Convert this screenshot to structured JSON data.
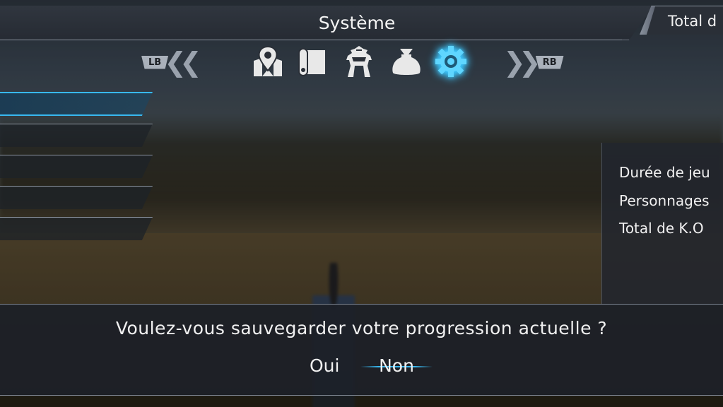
{
  "header": {
    "title": "Système",
    "total_tab_label": "Total d"
  },
  "tabs": {
    "left_shoulder": "LB",
    "right_shoulder": "RB",
    "icons": [
      {
        "name": "map-icon",
        "active": false
      },
      {
        "name": "scroll-icon",
        "active": false
      },
      {
        "name": "helmet-icon",
        "active": false
      },
      {
        "name": "bag-icon",
        "active": false
      },
      {
        "name": "gear-icon",
        "active": true
      }
    ],
    "accent_color": "#3cc8ff"
  },
  "menu": {
    "item_count": 5,
    "selected_index": 0
  },
  "stats": {
    "rows": [
      {
        "label": "Durée de jeu"
      },
      {
        "label": "Personnages"
      },
      {
        "label": "Total de K.O"
      }
    ]
  },
  "dialog": {
    "question": "Voulez-vous sauvegarder votre progression actuelle ?",
    "options": [
      {
        "label": "Oui",
        "selected": false
      },
      {
        "label": "Non",
        "selected": true
      }
    ]
  }
}
